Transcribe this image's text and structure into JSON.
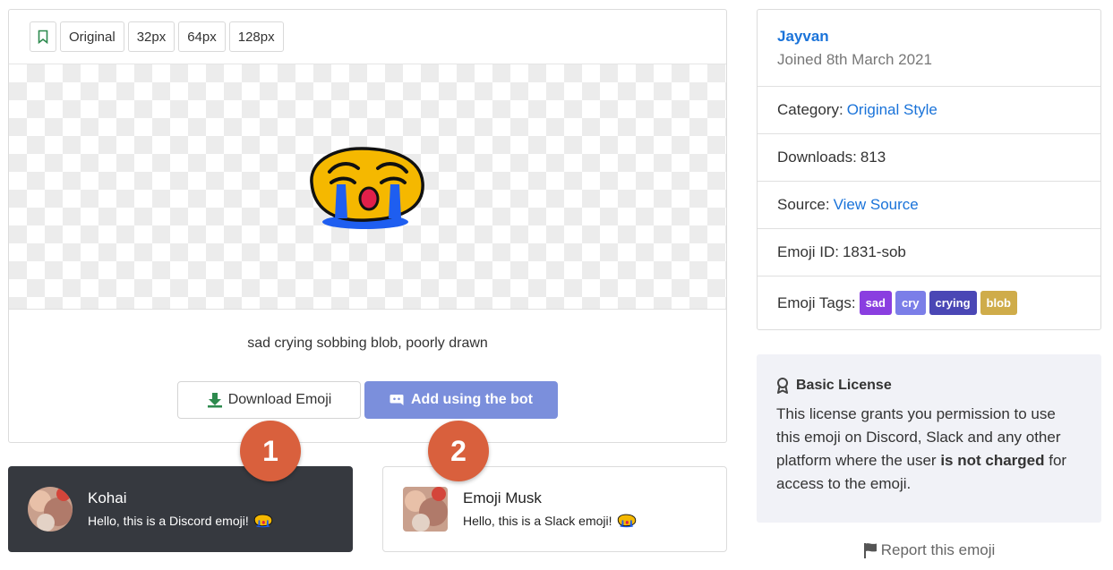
{
  "toolbar": {
    "bookmark_icon": "bookmark-icon",
    "sizes": [
      "Original",
      "32px",
      "64px",
      "128px"
    ]
  },
  "emoji": {
    "description": "sad crying sobbing blob, poorly drawn"
  },
  "actions": {
    "download_label": "Download Emoji",
    "bot_label": "Add using the bot",
    "download_color": "#2d8a4e",
    "bot_color": "#7b8fdc"
  },
  "previews": {
    "discord": {
      "name": "Kohai",
      "message": "Hello, this is a Discord emoji!",
      "step": "1"
    },
    "slack": {
      "name": "Emoji Musk",
      "message": "Hello, this is a Slack emoji!",
      "step": "2"
    }
  },
  "info": {
    "author": "Jayvan",
    "joined": "Joined 8th March 2021",
    "category_label": "Category:",
    "category_value": "Original Style",
    "downloads_label": "Downloads:",
    "downloads_value": "813",
    "source_label": "Source:",
    "source_value": "View Source",
    "emoji_id_label": "Emoji ID:",
    "emoji_id_value": "1831-sob",
    "tags_label": "Emoji Tags:",
    "tags": [
      {
        "label": "sad",
        "color": "#8a3ee0"
      },
      {
        "label": "cry",
        "color": "#7b7ee8"
      },
      {
        "label": "crying",
        "color": "#4a47b5"
      },
      {
        "label": "blob",
        "color": "#cfac4a"
      }
    ]
  },
  "license": {
    "title": "Basic License",
    "text_before": "This license grants you permission to use this emoji on Discord, Slack and any other platform where the user ",
    "text_bold": "is not charged",
    "text_after": " for access to the emoji."
  },
  "report": {
    "label": "Report this emoji"
  }
}
